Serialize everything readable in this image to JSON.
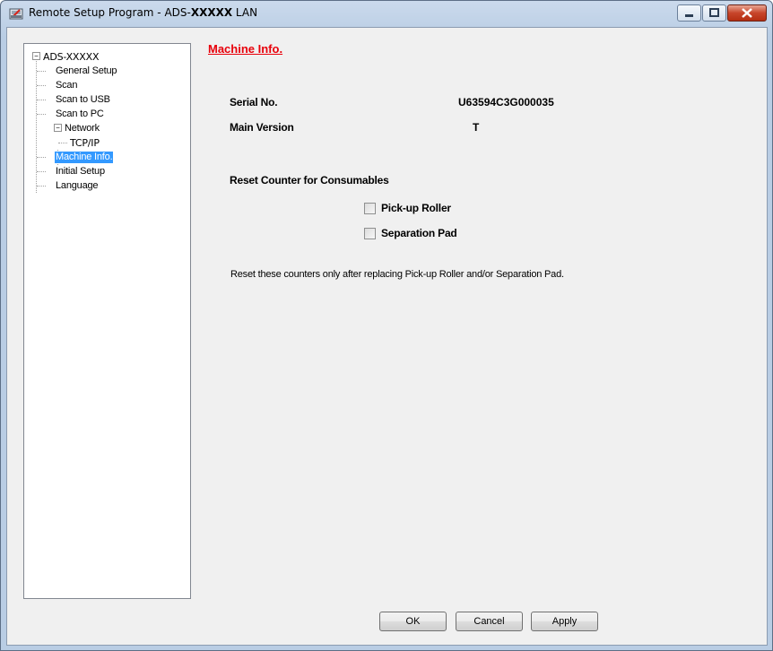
{
  "window": {
    "title_prefix": "Remote Setup Program - ADS-",
    "title_model": "XXXXX",
    "title_suffix": " LAN"
  },
  "tree": {
    "root": "ADS-XXXXX",
    "items": [
      "General Setup",
      "Scan",
      "Scan to USB",
      "Scan to PC",
      "Network",
      "TCP/IP",
      "Machine Info.",
      "Initial Setup",
      "Language"
    ],
    "selected": "Machine Info."
  },
  "main": {
    "title": "Machine Info.",
    "serial_label": "Serial No.",
    "serial_value": "U63594C3G000035",
    "version_label": "Main Version",
    "version_value": "T",
    "reset_heading": "Reset Counter for Consumables",
    "checkboxes": [
      {
        "label": "Pick-up Roller",
        "checked": false
      },
      {
        "label": "Separation Pad",
        "checked": false
      }
    ],
    "note": "Reset these counters only after replacing Pick-up Roller and/or Separation Pad."
  },
  "buttons": {
    "ok": "OK",
    "cancel": "Cancel",
    "apply": "Apply"
  },
  "colors": {
    "title_accent": "#e8000b",
    "selection": "#3399ff"
  }
}
